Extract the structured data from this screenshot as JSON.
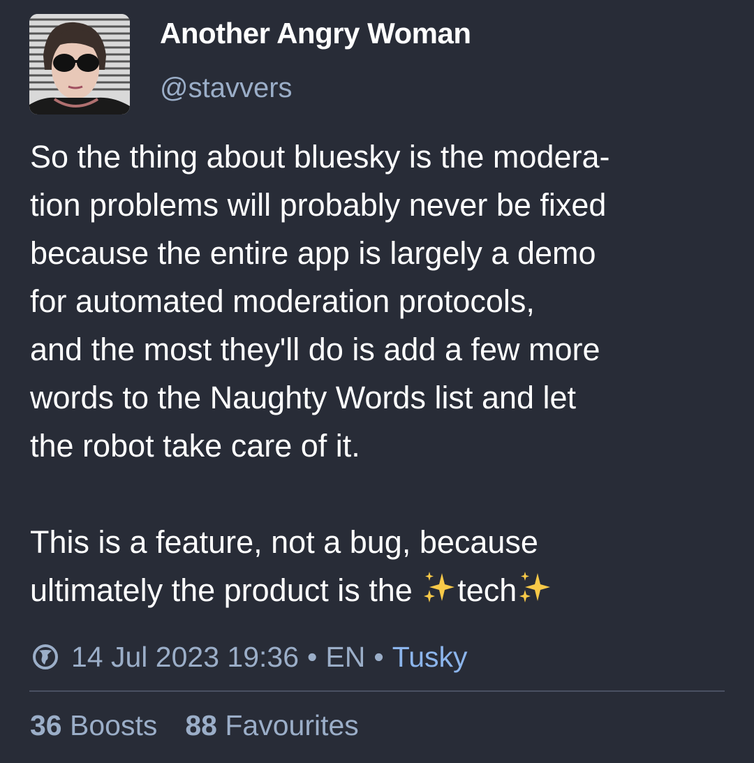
{
  "account": {
    "display_name": "Another Angry Woman",
    "handle": "@stavvers",
    "avatar_icon": "avatar-photo"
  },
  "status": {
    "lines_para1": [
      "So the thing about bluesky is the modera-",
      "tion problems will probably never be fixed",
      "because the entire app is largely a demo",
      "for automated moderation protocols,",
      "and the most they'll do is add a few more",
      "words to the Naughty Words list and let",
      "the robot take care of it."
    ],
    "para2_line1": "This is a feature, not a bug, because",
    "para2_line2_prefix": "ultimately the product is the ",
    "para2_line2_word": "tech",
    "emoji": "sparkles"
  },
  "meta": {
    "visibility_icon": "globe-icon",
    "date": "14 Jul 2023 19:36",
    "separator": "•",
    "language": "EN",
    "application": "Tusky"
  },
  "stats": {
    "boosts_count": "36",
    "boosts_label": "Boosts",
    "favourites_count": "88",
    "favourites_label": "Favourites"
  },
  "colors": {
    "background": "#282c37",
    "text": "#ffffff",
    "secondary": "#9baec8",
    "link": "#8cb5ec"
  }
}
